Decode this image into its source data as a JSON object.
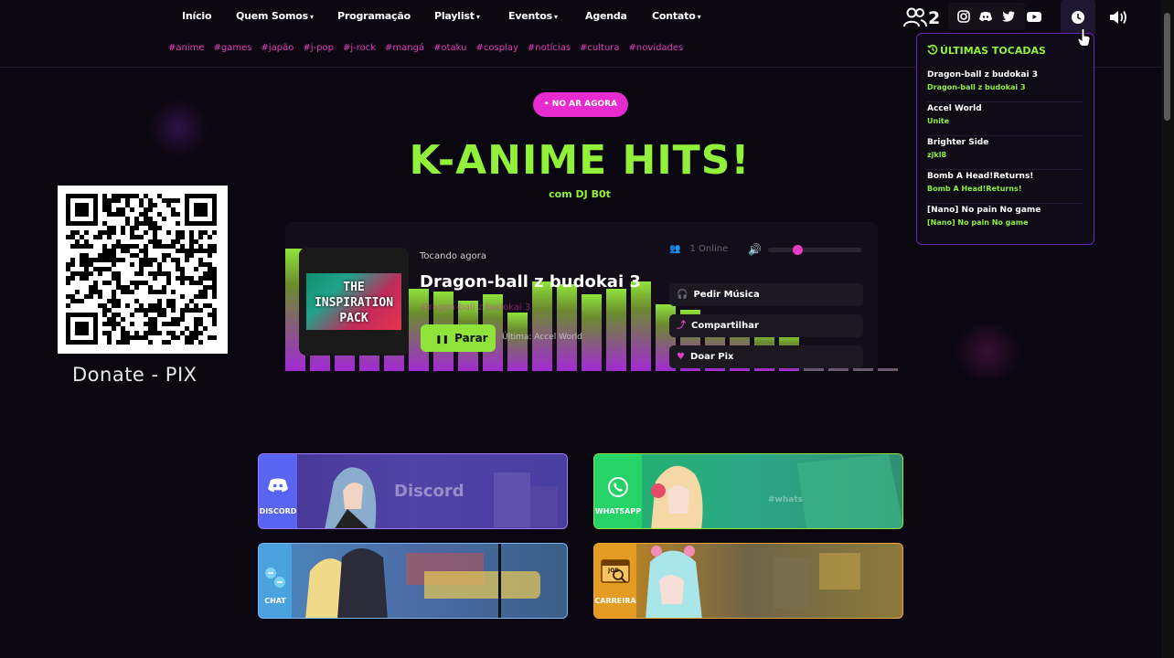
{
  "nav": {
    "items": [
      {
        "label": "Início",
        "caret": false
      },
      {
        "label": "Quem Somos",
        "caret": true
      },
      {
        "label": "Programação",
        "caret": false
      },
      {
        "label": "Playlist",
        "caret": true
      },
      {
        "label": "Eventos",
        "caret": true
      },
      {
        "label": "Agenda",
        "caret": false
      },
      {
        "label": "Contato",
        "caret": true
      }
    ],
    "caret_glyph": "▾",
    "online_count": "2"
  },
  "hashtags": [
    "#anime",
    "#games",
    "#japão",
    "#j-pop",
    "#j-rock",
    "#mangá",
    "#otaku",
    "#cosplay",
    "#notícias",
    "#cultura",
    "#novidades"
  ],
  "hero": {
    "badge": "• NO AR AGORA",
    "title": "K-ANIME HITS!",
    "subtitle": "com DJ B0t"
  },
  "donate": {
    "label": "Donate - PIX"
  },
  "player": {
    "cover_text": [
      "THE",
      "INSPIRATION",
      "PACK"
    ],
    "now_playing_label": "Tocando agora",
    "song": "Dragon-ball z budokai 3",
    "artist": "Dragon-ball z budokai 3",
    "stop_label": "Parar",
    "last_played": "Última: Accel World",
    "online_label": "1 Online",
    "volume_level": 0.3,
    "actions": {
      "request": "Pedir Música",
      "share": "Compartilhar",
      "donate": "Doar Pix"
    },
    "visualizer_levels": [
      0.96,
      0.92,
      0.86,
      0.78,
      0.72,
      0.64,
      0.62,
      0.55,
      0.6,
      0.46,
      0.7,
      0.68,
      0.6,
      0.64,
      0.7,
      0.52,
      0.48,
      0.44,
      0.42,
      0.32,
      0.3,
      0.02,
      0.02,
      0.02,
      0.02
    ]
  },
  "recent": {
    "title": "ÚLTIMAS TOCADAS",
    "items": [
      {
        "name": "Dragon-ball z budokai 3",
        "artist": "Dragon-ball z budokai 3"
      },
      {
        "name": "Accel World",
        "artist": "Unite"
      },
      {
        "name": "Brighter Side",
        "artist": "zjkl8"
      },
      {
        "name": "Bomb A Head!Returns!",
        "artist": "Bomb A Head!Returns!"
      },
      {
        "name": "[Nano] No pain No game",
        "artist": "[Nano] No pain No game"
      }
    ]
  },
  "cards": {
    "discord": {
      "label": "DISCORD",
      "art_text": "Discord"
    },
    "whatsapp": {
      "label": "WHATSAPP",
      "art_text": "#whats"
    },
    "chat": {
      "label": "CHAT"
    },
    "careers": {
      "label": "CARREIRA",
      "badge": "JOB"
    }
  },
  "colors": {
    "accent_green": "#90f03a",
    "accent_pink": "#e72bd0",
    "background": "#0b0710"
  }
}
